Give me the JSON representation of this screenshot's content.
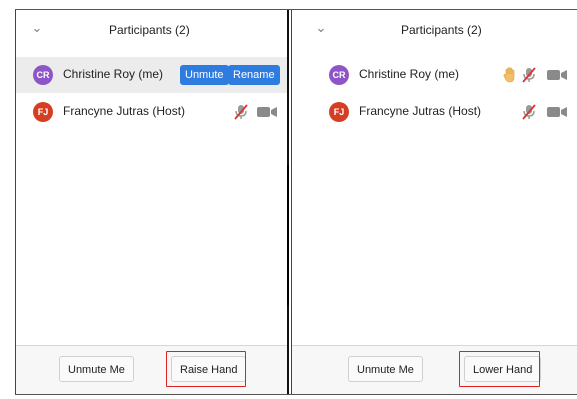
{
  "panels": [
    {
      "header": {
        "chevron_icon": "chevron-down-icon",
        "title": "Participants (2)"
      },
      "participants": [
        {
          "initials": "CR",
          "name": "Christine Roy (me)",
          "avatar_color": "#8e55c7",
          "highlighted": true,
          "actions": [
            "Unmute",
            "Rename"
          ]
        },
        {
          "initials": "FJ",
          "name": "Francyne Jutras (Host)",
          "avatar_color": "#d43f24",
          "icons": [
            "mic-muted-icon",
            "video-camera-icon"
          ]
        }
      ],
      "footer": {
        "unmute_me": "Unmute Me",
        "hand_button": "Raise Hand"
      }
    },
    {
      "header": {
        "chevron_icon": "chevron-down-icon",
        "title": "Participants (2)"
      },
      "participants": [
        {
          "initials": "CR",
          "name": "Christine Roy (me)",
          "avatar_color": "#8e55c7",
          "icons": [
            "raised-hand-icon",
            "mic-muted-icon",
            "video-camera-icon"
          ]
        },
        {
          "initials": "FJ",
          "name": "Francyne Jutras (Host)",
          "avatar_color": "#d43f24",
          "icons": [
            "mic-muted-icon",
            "video-camera-icon"
          ]
        }
      ],
      "footer": {
        "unmute_me": "Unmute Me",
        "hand_button": "Lower Hand"
      }
    }
  ],
  "colors": {
    "accent_blue": "#2f7ce0",
    "highlight_red": "#dd2222",
    "row_highlight": "#ececec"
  }
}
